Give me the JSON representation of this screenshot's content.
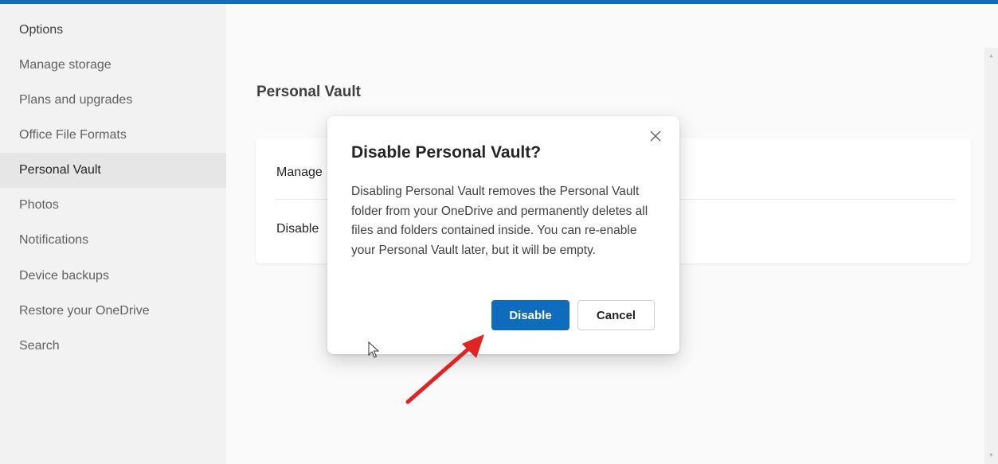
{
  "sidebar": {
    "header": "Options",
    "items": [
      {
        "label": "Manage storage"
      },
      {
        "label": "Plans and upgrades"
      },
      {
        "label": "Office File Formats"
      },
      {
        "label": "Personal Vault",
        "selected": true
      },
      {
        "label": "Photos"
      },
      {
        "label": "Notifications"
      },
      {
        "label": "Device backups"
      },
      {
        "label": "Restore your OneDrive"
      },
      {
        "label": "Search"
      }
    ]
  },
  "main": {
    "section_title": "Personal Vault",
    "card": {
      "rows": [
        {
          "label": "Manage"
        },
        {
          "label": "Disable"
        }
      ]
    }
  },
  "dialog": {
    "title": "Disable Personal Vault?",
    "close_icon": "close-icon",
    "body": "Disabling Personal Vault removes the Personal Vault folder from your OneDrive and permanently deletes all files and folders contained inside. You can re-enable your Personal Vault later, but it will be empty.",
    "primary_button": "Disable",
    "secondary_button": "Cancel"
  },
  "colors": {
    "accent": "#0f6cbd",
    "annotation_arrow": "#e02424"
  }
}
